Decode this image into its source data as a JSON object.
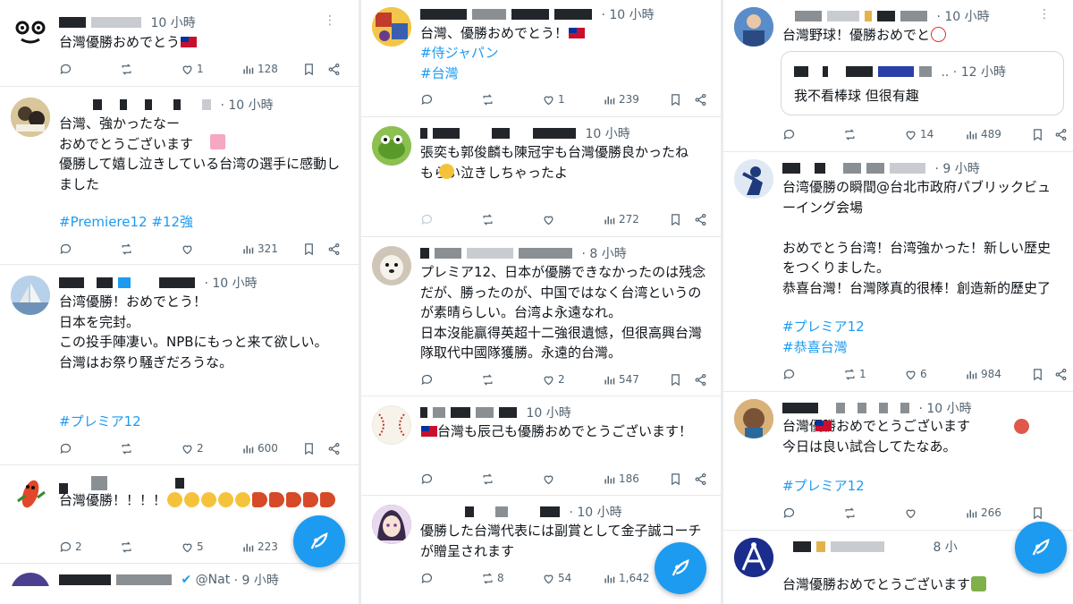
{
  "col1": {
    "tweets": [
      {
        "time": "10 小時",
        "body": "台灣優勝おめでとう",
        "actions": {
          "reply": "",
          "retweet": "",
          "like": "1",
          "views": "128"
        }
      },
      {
        "time": "· 10 小時",
        "body": "台灣、強かったなー\nおめでとうございます\n優勝して嬉し泣きしている台湾の選手に感動しました",
        "tags": "#Premiere12 #12強",
        "actions": {
          "reply": "",
          "retweet": "",
          "like": "",
          "views": "321"
        }
      },
      {
        "time": "· 10 小時",
        "body": "台湾優勝！おめでとう！\n日本を完封。\nこの投手陣凄い。NPBにもっと来て欲しい。\n台灣はお祭り騒ぎだろうな。",
        "tags": "#プレミア12",
        "actions": {
          "reply": "",
          "retweet": "",
          "like": "2",
          "views": "600"
        }
      },
      {
        "time": "",
        "body": "台灣優勝！！！！",
        "actions": {
          "reply": "2",
          "retweet": "",
          "like": "5",
          "views": "223"
        }
      },
      {
        "handle": "@Nat",
        "time": "· 9 小時"
      }
    ]
  },
  "col2": {
    "tweets": [
      {
        "time": "· 10 小時",
        "body": "台灣、優勝おめでとう！",
        "tags": "#侍ジャパン\n#台灣",
        "actions": {
          "reply": "",
          "retweet": "",
          "like": "1",
          "views": "239"
        }
      },
      {
        "time": "10 小時",
        "body": "張奕も郭俊麟も陳冠宇も台灣優勝良かったね\nもらい泣きしちゃったよ",
        "actions": {
          "reply": "",
          "retweet": "",
          "like": "",
          "views": "272"
        }
      },
      {
        "time": "· 8 小時",
        "body": "プレミア12、日本が優勝できなかったのは残念だが、勝ったのが、中国ではなく台湾というのが素晴らしい。台湾よ永遠なれ。\n日本沒能贏得英超十二強很遺憾，但很高興台灣隊取代中國隊獲勝。永遠的台灣。",
        "actions": {
          "reply": "",
          "retweet": "",
          "like": "2",
          "views": "547"
        }
      },
      {
        "time": "10 小時",
        "body": "台灣も辰己も優勝おめでとうございます！",
        "actions": {
          "reply": "",
          "retweet": "",
          "like": "",
          "views": "186"
        }
      },
      {
        "time": "· 10 小時",
        "body": "優勝した台灣代表には副賞として金子誠コーチが贈呈されます",
        "actions": {
          "reply": "",
          "retweet": "8",
          "like": "54",
          "views": "1,642"
        }
      }
    ]
  },
  "col3": {
    "tweets": [
      {
        "time": "· 10 小時",
        "body": "台灣野球！優勝おめでと",
        "quote": {
          "time": ".. · 12 小時",
          "body": "我不看棒球 但很有趣"
        },
        "actions": {
          "reply": "",
          "retweet": "",
          "like": "14",
          "views": "489"
        }
      },
      {
        "time": "· 9 小時",
        "body": "台湾優勝の瞬間@台北市政府パブリックビューイング会場\n\nおめでとう台湾！台湾強かった！新しい歴史をつくりました。\n恭喜台灣！台灣隊真的很棒！創造新的歷史了",
        "tags": "#プレミア12\n#恭喜台灣",
        "actions": {
          "reply": "",
          "retweet": "1",
          "like": "6",
          "views": "984"
        }
      },
      {
        "time": "· 10 小時",
        "body": "台灣優勝おめでとうございます\n今日は良い試合してたなあ。",
        "tags": "#プレミア12",
        "actions": {
          "reply": "",
          "retweet": "",
          "like": "",
          "views": "266"
        }
      },
      {
        "time": "8 小",
        "body": "台灣優勝おめでとうございます"
      }
    ]
  },
  "icons": [
    "reply-icon",
    "retweet-icon",
    "like-icon",
    "views-icon",
    "bookmark-icon",
    "share-icon",
    "compose-icon",
    "more-icon"
  ],
  "colors": {
    "accent": "#1d9bf0",
    "text": "#0f1419",
    "muted": "#536471",
    "divider": "#e6e9eb"
  }
}
